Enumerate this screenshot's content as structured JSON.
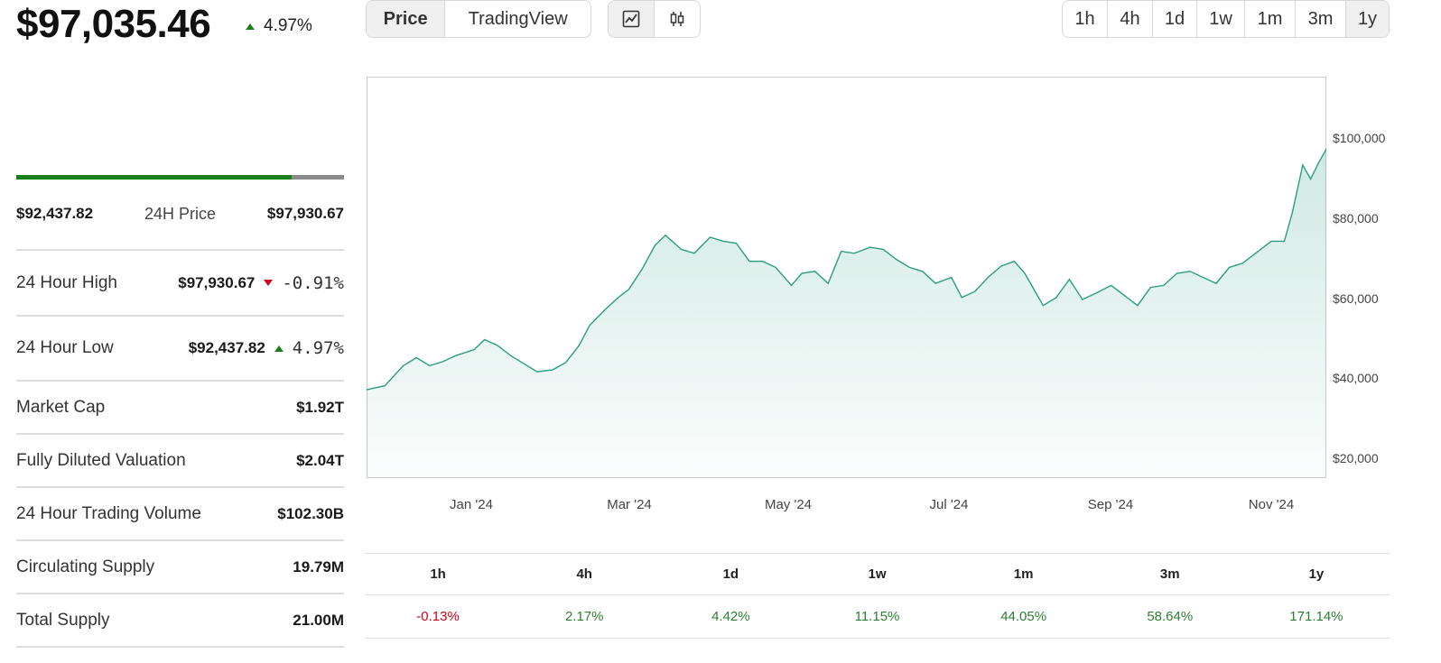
{
  "header": {
    "price": "$97,035.46",
    "change": "4.97%"
  },
  "view_toggle": {
    "options": [
      "Price",
      "TradingView"
    ],
    "active": "Price"
  },
  "chart_toggle": {
    "options": [
      "line-chart-icon",
      "candlestick-icon"
    ],
    "active": "line-chart-icon"
  },
  "timeframes": {
    "options": [
      "1h",
      "4h",
      "1d",
      "1w",
      "1m",
      "3m",
      "1y"
    ],
    "active": "1y"
  },
  "range_24h": {
    "low": "$92,437.82",
    "label": "24H Price",
    "high": "$97,930.67",
    "position": 0.84
  },
  "stats": {
    "high_label": "24 Hour High",
    "high_value": "$97,930.67",
    "high_pct": "-0.91%",
    "low_label": "24 Hour Low",
    "low_value": "$92,437.82",
    "low_pct": "4.97%",
    "rows": [
      {
        "label": "Market Cap",
        "value": "$1.92T"
      },
      {
        "label": "Fully Diluted Valuation",
        "value": "$2.04T"
      },
      {
        "label": "24 Hour Trading Volume",
        "value": "$102.30B"
      },
      {
        "label": "Circulating Supply",
        "value": "19.79M"
      },
      {
        "label": "Total Supply",
        "value": "21.00M"
      }
    ]
  },
  "performance": {
    "periods": [
      "1h",
      "4h",
      "1d",
      "1w",
      "1m",
      "3m",
      "1y"
    ],
    "values": [
      "-0.13%",
      "2.17%",
      "4.42%",
      "11.15%",
      "44.05%",
      "58.64%",
      "171.14%"
    ]
  },
  "colors": {
    "line": "#2a9d7f",
    "positive": "#2e7d32",
    "negative": "#d0021b",
    "range_fill": "#1a7f1a"
  },
  "chart_data": {
    "type": "area",
    "x_tick_labels": [
      "Jan '24",
      "Mar '24",
      "May '24",
      "Jul '24",
      "Sep '24",
      "Nov '24"
    ],
    "y_tick_labels": [
      "$100,000",
      "$80,000",
      "$60,000",
      "$40,000",
      "$20,000"
    ],
    "y_ticks": [
      100000,
      80000,
      60000,
      40000,
      20000
    ],
    "ylim": [
      10000,
      110000
    ],
    "xlim": [
      "2023-11-21",
      "2024-11-21"
    ],
    "grid": false,
    "series": [
      {
        "x": [
          "2023-11-21",
          "2023-11-28",
          "2023-12-05",
          "2023-12-10",
          "2023-12-15",
          "2023-12-20",
          "2023-12-25",
          "2024-01-01",
          "2024-01-05",
          "2024-01-10",
          "2024-01-15",
          "2024-01-20",
          "2024-01-25",
          "2024-01-31",
          "2024-02-05",
          "2024-02-10",
          "2024-02-14",
          "2024-02-20",
          "2024-02-25",
          "2024-02-29",
          "2024-03-05",
          "2024-03-10",
          "2024-03-14",
          "2024-03-20",
          "2024-03-25",
          "2024-03-31",
          "2024-04-05",
          "2024-04-10",
          "2024-04-15",
          "2024-04-20",
          "2024-04-25",
          "2024-05-01",
          "2024-05-05",
          "2024-05-10",
          "2024-05-15",
          "2024-05-20",
          "2024-05-25",
          "2024-05-31",
          "2024-06-05",
          "2024-06-10",
          "2024-06-15",
          "2024-06-20",
          "2024-06-25",
          "2024-07-01",
          "2024-07-05",
          "2024-07-10",
          "2024-07-15",
          "2024-07-20",
          "2024-07-25",
          "2024-07-29",
          "2024-08-05",
          "2024-08-10",
          "2024-08-15",
          "2024-08-20",
          "2024-08-25",
          "2024-08-31",
          "2024-09-06",
          "2024-09-10",
          "2024-09-15",
          "2024-09-20",
          "2024-09-25",
          "2024-09-30",
          "2024-10-05",
          "2024-10-10",
          "2024-10-15",
          "2024-10-20",
          "2024-10-25",
          "2024-10-31",
          "2024-11-05",
          "2024-11-08",
          "2024-11-12",
          "2024-11-15",
          "2024-11-18",
          "2024-11-21"
        ],
        "values": [
          32000,
          33000,
          38000,
          40000,
          38000,
          39000,
          40500,
          42000,
          44500,
          43000,
          40500,
          38500,
          36500,
          37000,
          38800,
          43000,
          48000,
          52000,
          55000,
          57000,
          62000,
          68000,
          70500,
          67000,
          66000,
          70000,
          69000,
          68500,
          64000,
          64000,
          62500,
          58000,
          61000,
          61500,
          58500,
          66500,
          66000,
          67500,
          67000,
          64500,
          62500,
          61500,
          58500,
          60000,
          55000,
          56500,
          60000,
          62800,
          64000,
          61000,
          53000,
          55000,
          59500,
          54500,
          56000,
          58000,
          55000,
          53000,
          57500,
          58000,
          61000,
          61500,
          60000,
          58500,
          62500,
          63500,
          66000,
          69000,
          69000,
          76000,
          88000,
          84500,
          88500,
          92000
        ]
      }
    ]
  }
}
